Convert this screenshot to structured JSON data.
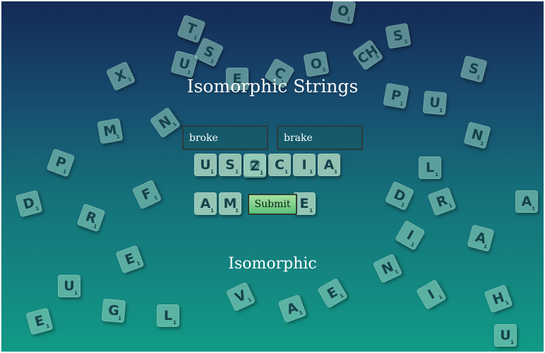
{
  "page": {
    "title": "Isomorphic Strings",
    "result": "Isomorphic"
  },
  "form": {
    "first_value": "broke",
    "second_value": "brake",
    "submit_label": "Submit"
  },
  "background": {
    "tile_letters": [
      "T",
      "S",
      "U",
      "S",
      "X",
      "E",
      "C",
      "O",
      "CH",
      "S",
      "P",
      "U",
      "M",
      "N",
      "N",
      "P",
      "U",
      "S",
      "O",
      "C",
      "I",
      "A",
      "L",
      "F",
      "D",
      "R",
      "A",
      "M",
      "E",
      "D",
      "I",
      "A",
      "E",
      "U",
      "N",
      "E",
      "G",
      "L",
      "V",
      "A",
      "I",
      "H",
      "E",
      "Z",
      "R",
      "A",
      "O",
      "U"
    ]
  },
  "colors": {
    "gradient_top": "#142a55",
    "gradient_bottom": "#129a86",
    "button_green": "#5ac278"
  }
}
